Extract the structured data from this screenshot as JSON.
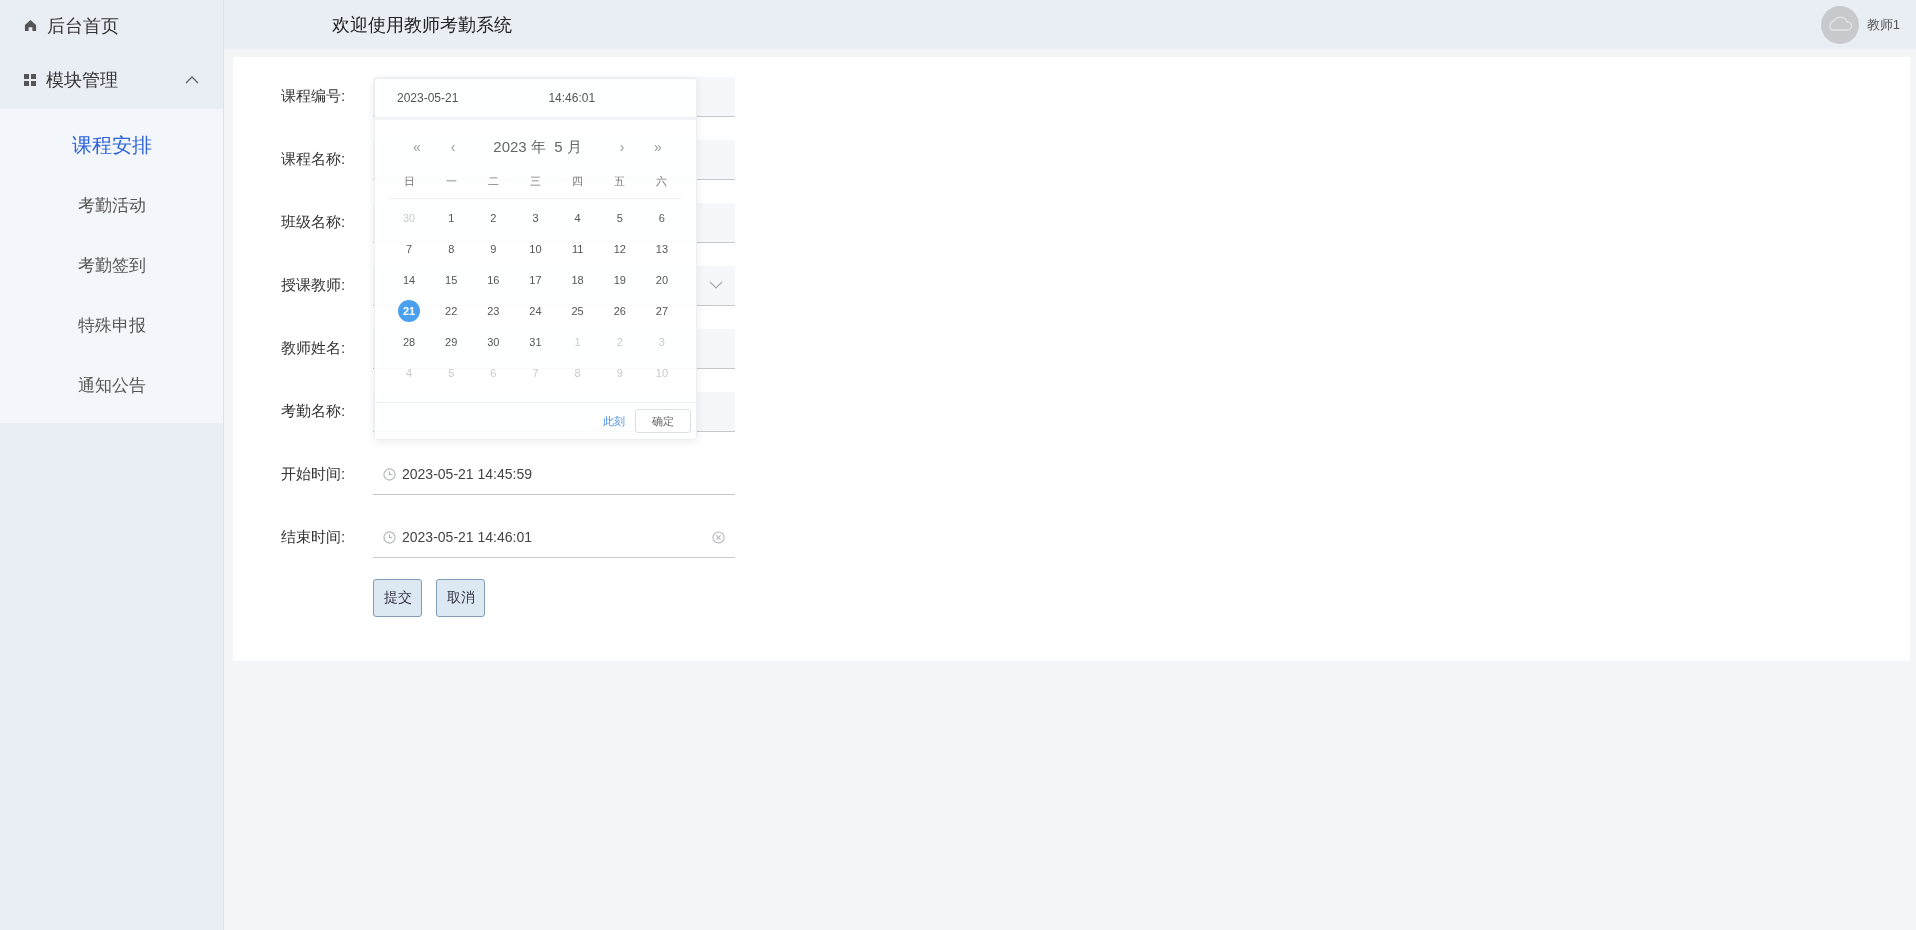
{
  "sidebar": {
    "home": {
      "label": "后台首页"
    },
    "menu": {
      "label": "模块管理",
      "expanded": true,
      "items": [
        {
          "label": "课程安排",
          "selected": true
        },
        {
          "label": "考勤活动",
          "selected": false
        },
        {
          "label": "考勤签到",
          "selected": false
        },
        {
          "label": "特殊申报",
          "selected": false
        },
        {
          "label": "通知公告",
          "selected": false
        }
      ]
    }
  },
  "header": {
    "title": "欢迎使用教师考勤系统",
    "user": {
      "name": "教师1"
    }
  },
  "form": {
    "fields": [
      {
        "label": "课程编号:",
        "kind": "text"
      },
      {
        "label": "课程名称:",
        "kind": "text"
      },
      {
        "label": "班级名称:",
        "kind": "text"
      },
      {
        "label": "授课教师:",
        "kind": "select"
      },
      {
        "label": "教师姓名:",
        "kind": "text"
      },
      {
        "label": "考勤名称:",
        "kind": "text"
      },
      {
        "label": "开始时间:",
        "kind": "datetime",
        "value": "2023-05-21 14:45:59"
      },
      {
        "label": "结束时间:",
        "kind": "datetime",
        "value": "2023-05-21 14:46:01",
        "clearable": true
      }
    ],
    "buttons": [
      "提交",
      "取消"
    ]
  },
  "date_picker": {
    "date": "2023-05-21",
    "time": "14:46:01",
    "nav": [
      "«",
      "‹",
      "›",
      "»"
    ],
    "year_month": "2023 年  5 月",
    "weekdays": [
      "日",
      "一",
      "二",
      "三",
      "四",
      "五",
      "六"
    ],
    "weeks": [
      [
        {
          "day": "30",
          "muted": true,
          "selected": false
        },
        {
          "day": "1",
          "muted": false,
          "selected": false
        },
        {
          "day": "2",
          "muted": false,
          "selected": false
        },
        {
          "day": "3",
          "muted": false,
          "selected": false
        },
        {
          "day": "4",
          "muted": false,
          "selected": false
        },
        {
          "day": "5",
          "muted": false,
          "selected": false
        },
        {
          "day": "6",
          "muted": false,
          "selected": false
        }
      ],
      [
        {
          "day": "7",
          "muted": false,
          "selected": false
        },
        {
          "day": "8",
          "muted": false,
          "selected": false
        },
        {
          "day": "9",
          "muted": false,
          "selected": false
        },
        {
          "day": "10",
          "muted": false,
          "selected": false
        },
        {
          "day": "11",
          "muted": false,
          "selected": false
        },
        {
          "day": "12",
          "muted": false,
          "selected": false
        },
        {
          "day": "13",
          "muted": false,
          "selected": false
        }
      ],
      [
        {
          "day": "14",
          "muted": false,
          "selected": false
        },
        {
          "day": "15",
          "muted": false,
          "selected": false
        },
        {
          "day": "16",
          "muted": false,
          "selected": false
        },
        {
          "day": "17",
          "muted": false,
          "selected": false
        },
        {
          "day": "18",
          "muted": false,
          "selected": false
        },
        {
          "day": "19",
          "muted": false,
          "selected": false
        },
        {
          "day": "20",
          "muted": false,
          "selected": false
        }
      ],
      [
        {
          "day": "21",
          "muted": false,
          "selected": true
        },
        {
          "day": "22",
          "muted": false,
          "selected": false
        },
        {
          "day": "23",
          "muted": false,
          "selected": false
        },
        {
          "day": "24",
          "muted": false,
          "selected": false
        },
        {
          "day": "25",
          "muted": false,
          "selected": false
        },
        {
          "day": "26",
          "muted": false,
          "selected": false
        },
        {
          "day": "27",
          "muted": false,
          "selected": false
        }
      ],
      [
        {
          "day": "28",
          "muted": false,
          "selected": false
        },
        {
          "day": "29",
          "muted": false,
          "selected": false
        },
        {
          "day": "30",
          "muted": false,
          "selected": false
        },
        {
          "day": "31",
          "muted": false,
          "selected": false
        },
        {
          "day": "1",
          "muted": true,
          "selected": false
        },
        {
          "day": "2",
          "muted": true,
          "selected": false
        },
        {
          "day": "3",
          "muted": true,
          "selected": false
        }
      ],
      [
        {
          "day": "4",
          "muted": true,
          "selected": false
        },
        {
          "day": "5",
          "muted": true,
          "selected": false
        },
        {
          "day": "6",
          "muted": true,
          "selected": false
        },
        {
          "day": "7",
          "muted": true,
          "selected": false
        },
        {
          "day": "8",
          "muted": true,
          "selected": false
        },
        {
          "day": "9",
          "muted": true,
          "selected": false
        },
        {
          "day": "10",
          "muted": true,
          "selected": false
        }
      ]
    ],
    "now_link": "此刻",
    "confirm": "确定"
  }
}
